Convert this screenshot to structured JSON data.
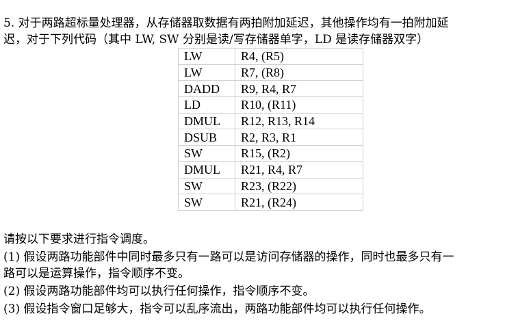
{
  "question": {
    "line1": "5. 对于两路超标量处理器，从存储器取数据有两拍附加延迟，其他操作均有一拍附加延",
    "line2": "迟，对于下列代码（其中 LW, SW 分别是读/写存储器单字，LD 是读存储器双字）"
  },
  "code_table": {
    "rows": [
      {
        "op": "LW",
        "args": "R4, (R5)"
      },
      {
        "op": "LW",
        "args": "R7, (R8)"
      },
      {
        "op": "DADD",
        "args": "R9, R4, R7"
      },
      {
        "op": "LD",
        "args": "R10, (R11)"
      },
      {
        "op": "DMUL",
        "args": "R12, R13, R14"
      },
      {
        "op": "DSUB",
        "args": "R2, R3, R1"
      },
      {
        "op": "SW",
        "args": "R15, (R2)"
      },
      {
        "op": "DMUL",
        "args": "R21, R4, R7"
      },
      {
        "op": "SW",
        "args": "R23, (R22)"
      },
      {
        "op": "SW",
        "args": "R21, (R24)"
      }
    ]
  },
  "requirements": {
    "intro": "请按以下要求进行指令调度。",
    "item1_line1": "(1) 假设两路功能部件中同时最多只有一路可以是访问存储器的操作，同时也最多只有一",
    "item1_line2": "路可以是运算操作，指令顺序不变。",
    "item2": "(2) 假设两路功能部件均可以执行任何操作，指令顺序不变。",
    "item3": "(3) 假设指令窗口足够大，指令可以乱序流出，两路功能部件均可以执行任何操作。"
  }
}
